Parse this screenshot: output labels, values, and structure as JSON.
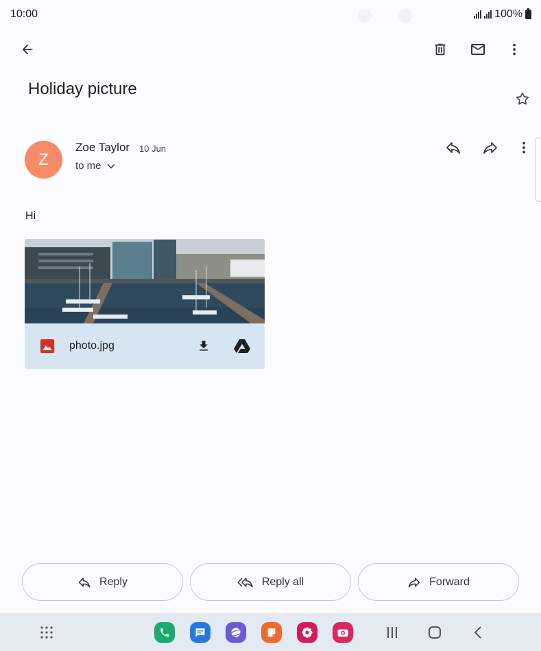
{
  "status_bar": {
    "time": "10:00",
    "battery": "100%"
  },
  "toolbar": {
    "back_icon": "arrow-back-icon",
    "delete_icon": "trash-icon",
    "mark_unread_icon": "mail-icon",
    "more_icon": "more-vert-icon"
  },
  "email": {
    "subject": "Holiday picture",
    "star_icon": "star-outline-icon",
    "sender": {
      "initial": "Z",
      "name": "Zoe Taylor",
      "date": "10 Jun",
      "recipient": "to me",
      "avatar_color": "#f98c67"
    },
    "body": "Hi",
    "attachment": {
      "filename": "photo.jpg",
      "type_icon": "image-icon",
      "download_icon": "download-icon",
      "drive_icon": "google-drive-icon"
    }
  },
  "actions": {
    "reply": "Reply",
    "reply_all": "Reply all",
    "forward": "Forward"
  },
  "navbar": {
    "apps": [
      "phone-icon",
      "messages-icon",
      "internet-icon",
      "notes-icon",
      "gallery-icon",
      "camera-icon"
    ],
    "app_colors": [
      "#1bab6c",
      "#2478e6",
      "#6a5ad8",
      "#f06a2d",
      "#d8195a",
      "#e0245e"
    ]
  }
}
